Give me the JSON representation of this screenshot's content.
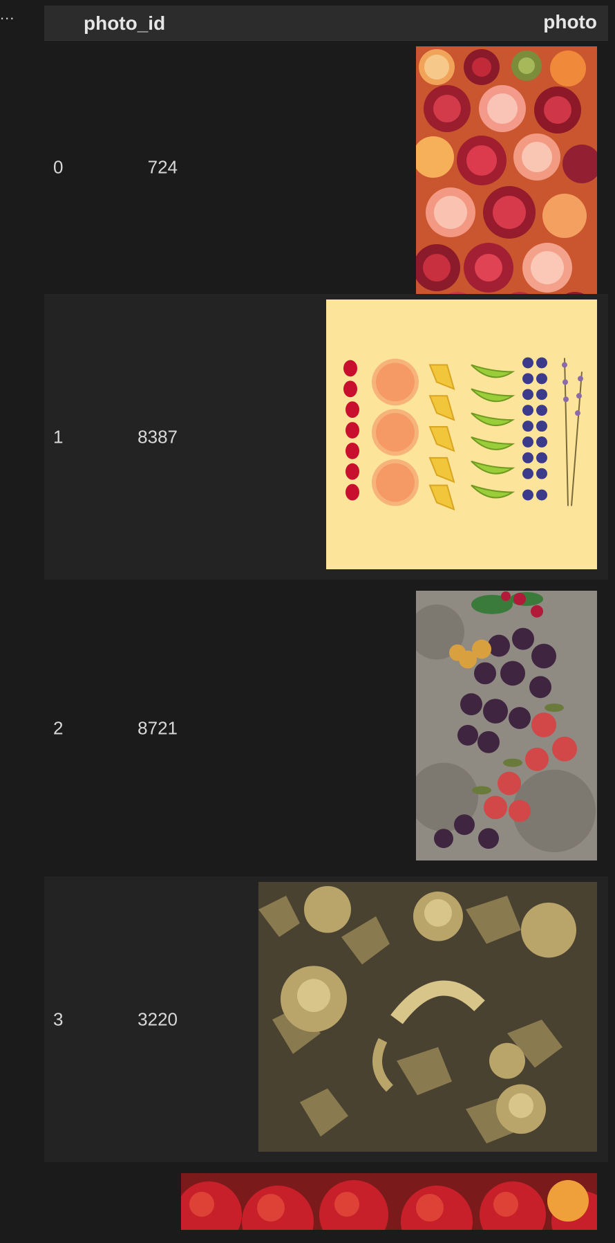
{
  "gutter": {
    "label": "..."
  },
  "table": {
    "headers": {
      "photo_id": "photo_id",
      "photo": "photo"
    },
    "rows": [
      {
        "index": "0",
        "photo_id": "724",
        "photo": "pomegranates-grapefruit-kiwi-icon"
      },
      {
        "index": "1",
        "photo_id": "8387",
        "photo": "fruit-flatlay-yellow-icon"
      },
      {
        "index": "2",
        "photo_id": "8721",
        "photo": "plums-apples-stone-icon"
      },
      {
        "index": "3",
        "photo_id": "3220",
        "photo": "gold-painted-fruits-icon"
      },
      {
        "index": "",
        "photo_id": "",
        "photo": "red-apples-icon"
      }
    ]
  },
  "colors": {
    "background": "#1b1b1b",
    "header": "#2c2c2c",
    "row_alt": "#232323",
    "text": "#d4d4d4"
  }
}
